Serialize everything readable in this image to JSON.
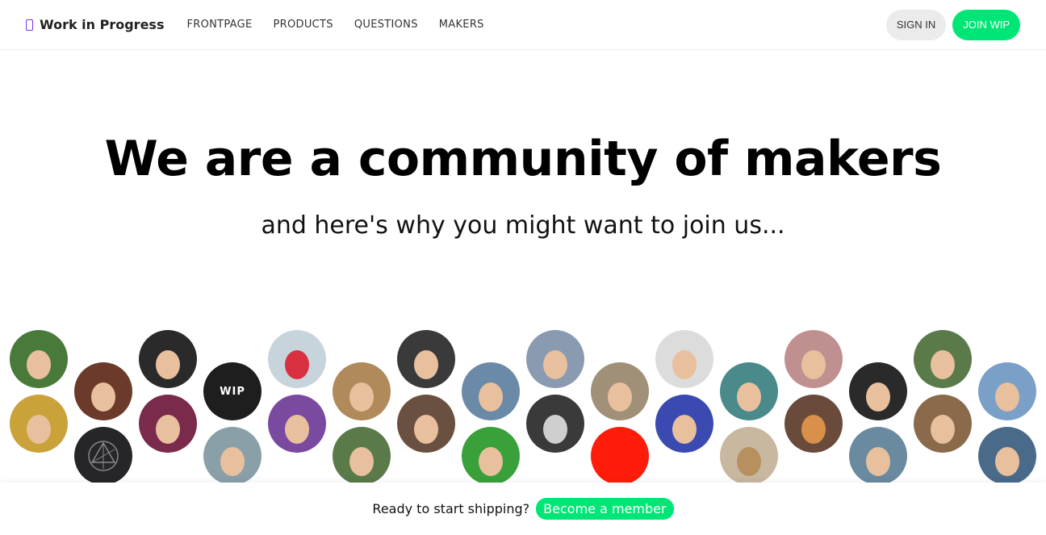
{
  "nav": {
    "brand": "Work in Progress",
    "links": [
      "FRONTPAGE",
      "PRODUCTS",
      "QUESTIONS",
      "MAKERS"
    ],
    "sign_in": "SIGN IN",
    "join": "JOIN WIP"
  },
  "hero": {
    "title": "We are a community of makers",
    "subtitle": "and here's why you might want to join us..."
  },
  "avatars": {
    "wip_label": "WIP"
  },
  "footer": {
    "prompt": "Ready to start shipping?",
    "cta": "Become a member"
  },
  "colors": {
    "accent": "#00e676",
    "brand_icon": "#7b2ff7"
  }
}
